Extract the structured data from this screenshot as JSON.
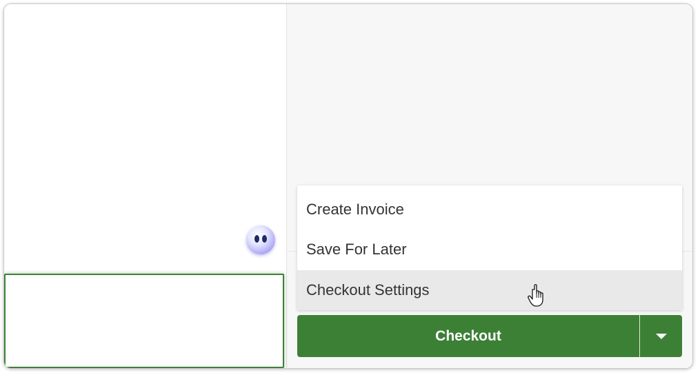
{
  "menu": {
    "items": [
      {
        "label": "Create Invoice"
      },
      {
        "label": "Save For Later"
      },
      {
        "label": "Checkout Settings"
      }
    ],
    "hovered_index": 2
  },
  "checkout": {
    "label": "Checkout"
  },
  "icons": {
    "assistant": "assistant-face-icon",
    "dropdown": "caret-down-icon",
    "cursor": "hand-pointer-icon"
  },
  "colors": {
    "accent_green": "#3c8036",
    "hover_gray": "#e9e9e9",
    "text_dark": "#333333",
    "assistant_purple": "#8a83ec"
  }
}
